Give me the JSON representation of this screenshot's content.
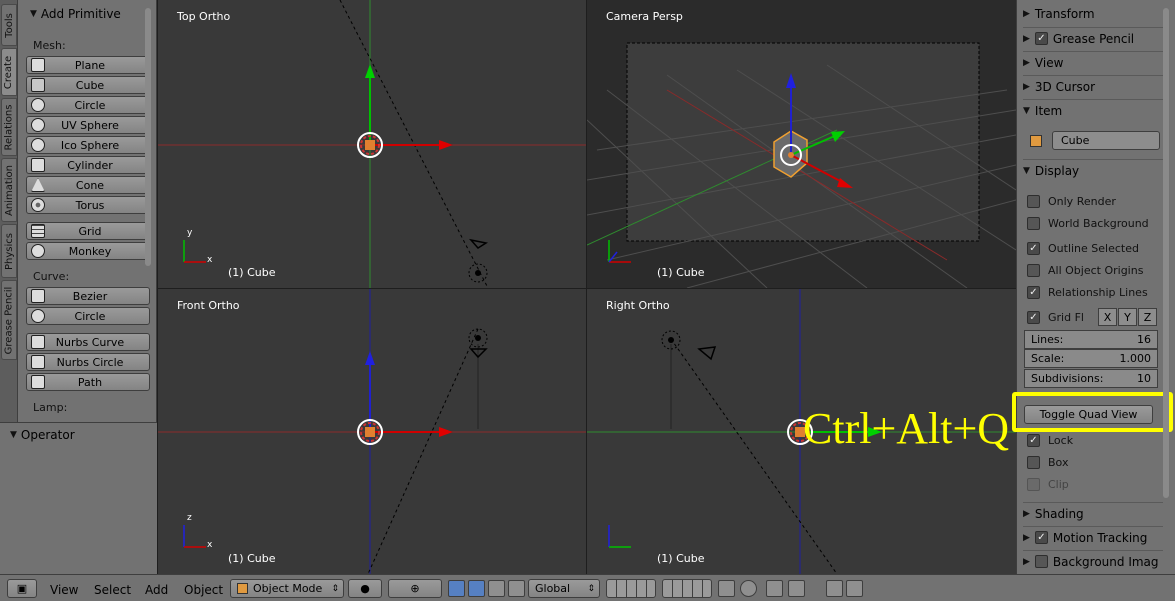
{
  "left_tabs": [
    "Tools",
    "Create",
    "Relations",
    "Animation",
    "Physics",
    "Grease Pencil"
  ],
  "shelf": {
    "title": "Add Primitive",
    "mesh_label": "Mesh:",
    "mesh": [
      "Plane",
      "Cube",
      "Circle",
      "UV Sphere",
      "Ico Sphere",
      "Cylinder",
      "Cone",
      "Torus"
    ],
    "mesh2": [
      "Grid",
      "Monkey"
    ],
    "curve_label": "Curve:",
    "curve": [
      "Bezier",
      "Circle"
    ],
    "curve2": [
      "Nurbs Curve",
      "Nurbs Circle",
      "Path"
    ],
    "lamp_label": "Lamp:"
  },
  "operator": {
    "title": "Operator"
  },
  "viewports": {
    "top": {
      "label": "Top Ortho",
      "object": "(1) Cube"
    },
    "camera": {
      "label": "Camera Persp",
      "object": "(1) Cube"
    },
    "front": {
      "label": "Front Ortho",
      "object": "(1) Cube"
    },
    "right": {
      "label": "Right Ortho",
      "object": "(1) Cube"
    },
    "axis_y": "y",
    "axis_x": "x",
    "axis_z": "z"
  },
  "overlay_text": "Ctrl+Alt+Q",
  "highlight_color": "#ffff00",
  "right_panel": {
    "transform": "Transform",
    "grease_pencil": "Grease Pencil",
    "view": "View",
    "cursor": "3D Cursor",
    "item": "Item",
    "item_name": "Cube",
    "display": "Display",
    "only_render": "Only Render",
    "world_background": "World Background",
    "outline_selected": "Outline Selected",
    "all_object_origins": "All Object Origins",
    "relationship_lines": "Relationship Lines",
    "grid_floor": "Grid Fl",
    "x": "X",
    "y": "Y",
    "z": "Z",
    "lines_label": "Lines:",
    "lines_value": "16",
    "scale_label": "Scale:",
    "scale_value": "1.000",
    "subdiv_label": "Subdivisions:",
    "subdiv_value": "10",
    "toggle_quad": "Toggle Quad View",
    "lock": "Lock",
    "box": "Box",
    "clip": "Clip",
    "shading": "Shading",
    "motion_tracking": "Motion Tracking",
    "background_images": "Background Imag"
  },
  "header": {
    "view": "View",
    "select": "Select",
    "add": "Add",
    "object": "Object",
    "mode": "Object Mode",
    "orientation": "Global"
  }
}
